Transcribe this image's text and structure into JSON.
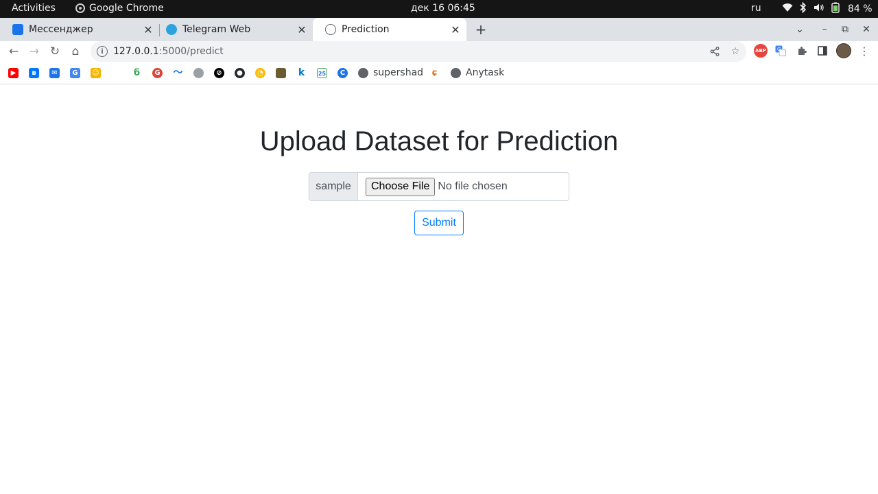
{
  "system_bar": {
    "activities": "Activities",
    "app_name": "Google Chrome",
    "clock": "дек 16  06:45",
    "language": "ru",
    "battery": "84 %"
  },
  "tabs": [
    {
      "title": "Мессенджер",
      "icon": "messenger-icon",
      "active": false
    },
    {
      "title": "Telegram Web",
      "icon": "telegram-icon",
      "active": false
    },
    {
      "title": "Prediction",
      "icon": "globe-icon",
      "active": true
    }
  ],
  "address_bar": {
    "host": "127.0.0.1",
    "path": ":5000/predict"
  },
  "bookmarks": [
    {
      "icon": "youtube-icon",
      "label": ""
    },
    {
      "icon": "vk-icon",
      "label": ""
    },
    {
      "icon": "mail-icon",
      "label": ""
    },
    {
      "icon": "translate-icon",
      "label": ""
    },
    {
      "icon": "classroom-icon",
      "label": ""
    },
    {
      "icon": "leaf-icon",
      "label": ""
    },
    {
      "icon": "chrome-red-icon",
      "label": ""
    },
    {
      "icon": "wave-icon",
      "label": ""
    },
    {
      "icon": "globe-icon",
      "label": ""
    },
    {
      "icon": "linear-icon",
      "label": ""
    },
    {
      "icon": "github-icon",
      "label": ""
    },
    {
      "icon": "yandex-icon",
      "label": ""
    },
    {
      "icon": "image-icon",
      "label": ""
    },
    {
      "icon": "k-icon",
      "label": ""
    },
    {
      "icon": "calendar-icon",
      "label": ""
    },
    {
      "icon": "c-icon",
      "label": ""
    },
    {
      "icon": "globe-icon",
      "label": "supershad"
    },
    {
      "icon": "flame-icon",
      "label": ""
    },
    {
      "icon": "globe-icon",
      "label": "Anytask"
    }
  ],
  "page": {
    "heading": "Upload Dataset for Prediction",
    "input_label": "sample",
    "choose_file": "Choose File",
    "no_file": "No file chosen",
    "submit": "Submit"
  },
  "colors": {
    "accent": "#007bff",
    "heading": "#212529",
    "tab_strip": "#dee1e6",
    "system_bar": "#151515"
  }
}
